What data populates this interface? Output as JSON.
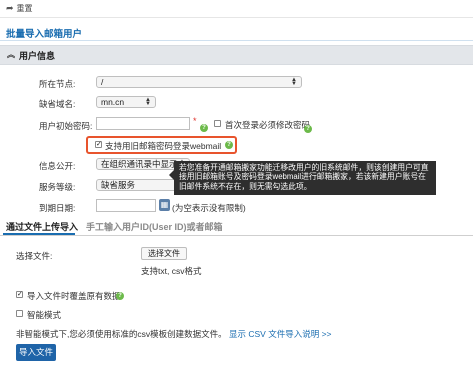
{
  "toolbar": {
    "reset_label": "重置"
  },
  "page_title": "批量导入邮箱用户",
  "section": {
    "title": "用户信息"
  },
  "form": {
    "node_label": "所在节点:",
    "node_value": "/",
    "domain_label": "缺省域名:",
    "domain_value": "mn.cn",
    "password_label": "用户初始密码:",
    "password_required": "*",
    "first_login_label": "首次登录必须修改密码",
    "webmail_label": "支持用旧邮箱密码登录webmail",
    "public_label": "信息公开:",
    "public_value": "在组织通讯录中显示",
    "service_label": "服务等级:",
    "service_value": "缺省服务",
    "service_required": "*",
    "expire_label": "到期日期:",
    "expire_hint": "(为空表示没有限制)"
  },
  "tooltip": {
    "text": "若您准备开通邮箱搬家功能迁移改用户的旧系统邮件，则该创建用户可直接用旧邮箱账号及密码登录webmail进行邮箱搬家，若该新建用户账号在旧邮件系统不存在，则无需勾选此项。"
  },
  "tabs": {
    "upload": "通过文件上传导入",
    "manual": "手工输入用户ID(User ID)或者邮箱"
  },
  "upload": {
    "file_label": "选择文件:",
    "choose_button": "选择文件",
    "formats": "支持txt, csv格式",
    "overwrite_label": "导入文件时覆盖原有数据",
    "smart_label": "智能模式",
    "note": "非智能模式下,您必须使用标准的csv模板创建数据文件。",
    "note_link": "显示 CSV 文件导入说明 >>",
    "import_button": "导入文件"
  },
  "colors": {
    "accent": "#1a6db0",
    "highlight": "#e8542d",
    "help": "#6cba4a"
  }
}
